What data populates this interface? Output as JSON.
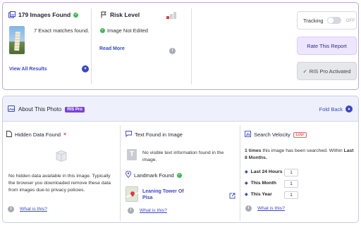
{
  "summary": {
    "images_found": "179 Images Found",
    "exact_matches": "7 Exact matches found.",
    "view_all": "View All Results",
    "risk_title": "Risk Level",
    "not_edited": "Image Not Edited",
    "read_more": "Read More",
    "tracking_label": "Tracking",
    "tracking_state": "OFF",
    "rate_report": "Rate This Report",
    "pro_activated": "RIS Pro Activated"
  },
  "about": {
    "title": "About This Photo",
    "badge": "RIS Pro",
    "fold_back": "Fold Back"
  },
  "hidden_data": {
    "title": "Hidden Data Found",
    "text": "No hidden data available in this image. Typically the browser you downloaded remove these data from images due-to privacy policies.",
    "what_is_this": "What is this?"
  },
  "text_found": {
    "title": "Text Found in Image",
    "text": "No visible text information found in the image.",
    "landmark_title": "Landmark Found",
    "landmark_line1": "Leaning Tower Of",
    "landmark_line2": "Pisa",
    "what_is_this": "What is this?"
  },
  "velocity": {
    "title": "Search Velocity",
    "badge": "Low",
    "times_bold": "1 times",
    "times_rest": " this image has been searched. Within ",
    "within_bold": "Last 8 Months.",
    "rows": [
      {
        "label": "Last 24 Hours",
        "value": "1"
      },
      {
        "label": "This Month",
        "value": "1"
      },
      {
        "label": "This Year",
        "value": "1"
      }
    ],
    "what_is_this": "What is this?"
  },
  "colors": {
    "accent": "#3a48c8",
    "pro_purple": "#7a3fe0",
    "success": "#3fb950",
    "danger": "#e03a3a"
  },
  "icons": [
    "image-stack-icon",
    "check-icon",
    "chevron-down-icon",
    "flag-icon",
    "risk-bars-icon",
    "info-icon",
    "photo-frame-icon",
    "chevron-up-icon",
    "x-icon",
    "file-icon",
    "chat-icon",
    "text-icon",
    "location-pin-icon",
    "external-link-icon",
    "chart-icon",
    "dot-icon"
  ]
}
